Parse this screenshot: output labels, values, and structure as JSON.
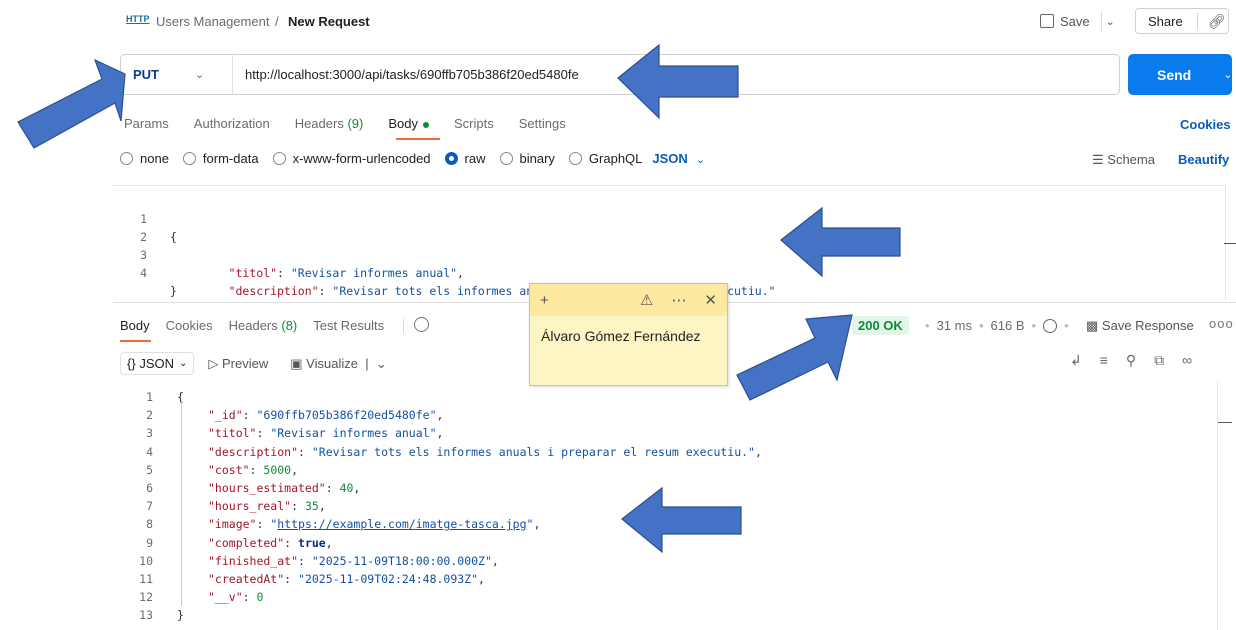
{
  "header": {
    "http_icon_text": "HTTP",
    "breadcrumb_parent": "Users Management",
    "breadcrumb_separator": "/",
    "breadcrumb_current": "New Request",
    "save_label": "Save",
    "share_label": "Share"
  },
  "request": {
    "method": "PUT",
    "url": "http://localhost:3000/api/tasks/690ffb705b386f20ed5480fe",
    "send_label": "Send",
    "tabs": [
      {
        "label": "Params"
      },
      {
        "label": "Authorization"
      },
      {
        "label": "Headers",
        "count": "(9)"
      },
      {
        "label": "Body"
      },
      {
        "label": "Scripts"
      },
      {
        "label": "Settings"
      }
    ],
    "cookies_label": "Cookies",
    "body_types": [
      "none",
      "form-data",
      "x-www-form-urlencoded",
      "raw",
      "binary",
      "GraphQL"
    ],
    "body_format": "JSON",
    "schema_label": "Schema",
    "beautify_label": "Beautify",
    "body_lines": [
      {
        "n": "1",
        "text": "{"
      },
      {
        "n": "2",
        "key": "\"titol\"",
        "value": "\"Revisar informes anual\"",
        "tail": ","
      },
      {
        "n": "3",
        "key": "\"description\"",
        "value": "\"Revisar tots els informes anuals i preparar el resum executiu.\"",
        "tail": ""
      },
      {
        "n": "4",
        "text": "}"
      }
    ]
  },
  "response": {
    "tabs": [
      {
        "label": "Body"
      },
      {
        "label": "Cookies"
      },
      {
        "label": "Headers",
        "count": "(8)"
      },
      {
        "label": "Test Results"
      }
    ],
    "status": "200 OK",
    "time": "31 ms",
    "size": "616 B",
    "save_response_label": "Save Response",
    "more_label": "ooo",
    "format": "JSON",
    "format_prefix": "{}",
    "preview_label": "Preview",
    "visualize_label": "Visualize",
    "lines": [
      {
        "n": "1",
        "text": "{"
      },
      {
        "n": "2",
        "key": "\"_id\"",
        "value": "\"690ffb705b386f20ed5480fe\"",
        "type": "str"
      },
      {
        "n": "3",
        "key": "\"titol\"",
        "value": "\"Revisar informes anual\"",
        "type": "str"
      },
      {
        "n": "4",
        "key": "\"description\"",
        "value": "\"Revisar tots els informes anuals i preparar el resum executiu.\"",
        "type": "str"
      },
      {
        "n": "5",
        "key": "\"cost\"",
        "value": "5000",
        "type": "num"
      },
      {
        "n": "6",
        "key": "\"hours_estimated\"",
        "value": "40",
        "type": "num"
      },
      {
        "n": "7",
        "key": "\"hours_real\"",
        "value": "35",
        "type": "num"
      },
      {
        "n": "8",
        "key": "\"image\"",
        "value": "https://example.com/imatge-tasca.jpg",
        "type": "url"
      },
      {
        "n": "9",
        "key": "\"completed\"",
        "value": "true",
        "type": "kw"
      },
      {
        "n": "10",
        "key": "\"finished_at\"",
        "value": "\"2025-11-09T18:00:00.000Z\"",
        "type": "str"
      },
      {
        "n": "11",
        "key": "\"createdAt\"",
        "value": "\"2025-11-09T02:24:48.093Z\"",
        "type": "str"
      },
      {
        "n": "12",
        "key": "\"__v\"",
        "value": "0",
        "type": "num",
        "last": true
      },
      {
        "n": "13",
        "text": "}"
      }
    ]
  },
  "sticky_note": {
    "add_label": "+",
    "text": "Álvaro Gómez Fernández"
  },
  "colors": {
    "accent": "#097bed",
    "status_ok": "#0f8a3c",
    "arrow_fill": "#4472c4",
    "sticky_bg": "#fdf5c4"
  }
}
